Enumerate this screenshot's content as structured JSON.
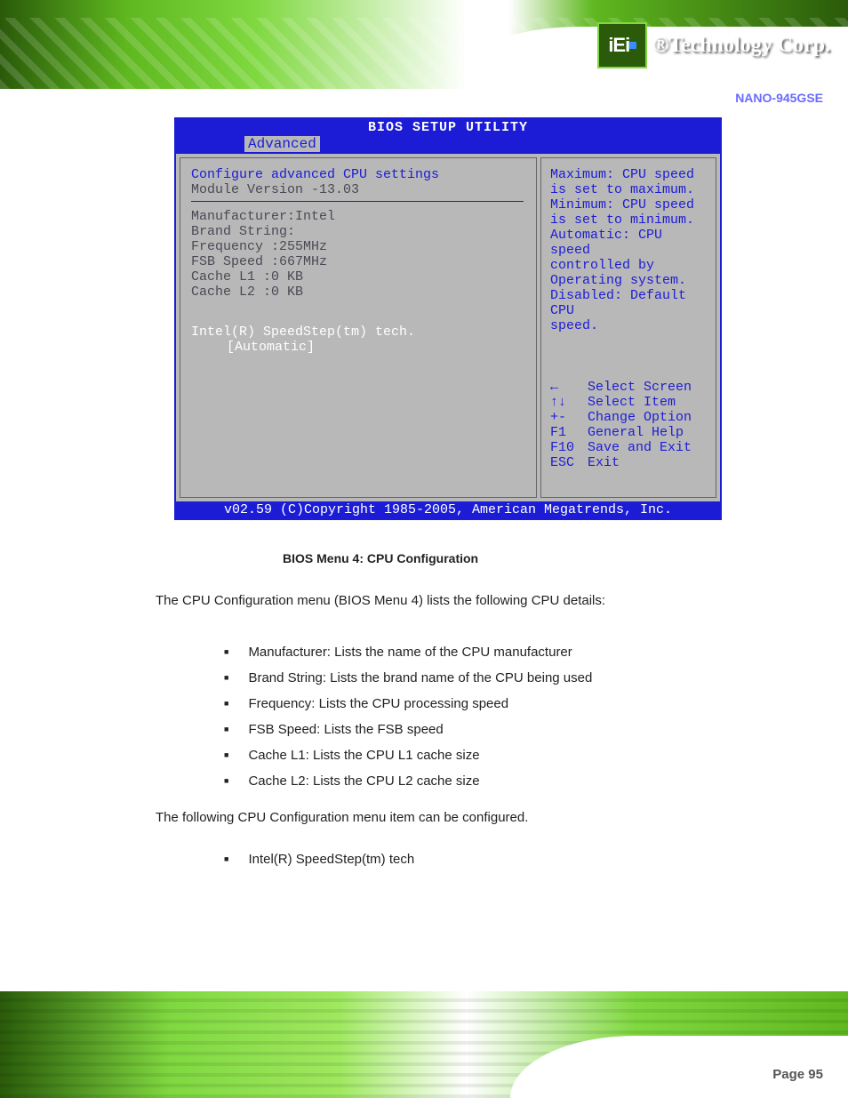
{
  "header": {
    "logo_text": "iEi",
    "brand": "®Technology Corp."
  },
  "product_label": "NANO-945GSE",
  "bios": {
    "title": "BIOS SETUP UTILITY",
    "active_tab": "Advanced",
    "left": {
      "heading": "Configure advanced CPU settings",
      "module": "Module Version -13.03",
      "rows": [
        "Manufacturer:Intel",
        "Brand String:",
        "Frequency   :255MHz",
        "FSB Speed   :667MHz",
        "",
        "Cache L1    :0 KB",
        "Cache L2    :0 KB"
      ],
      "option_label": "Intel(R) SpeedStep(tm) tech.",
      "option_value": "[Automatic]"
    },
    "right": {
      "help": [
        "Maximum: CPU speed",
        "is set to maximum.",
        "Minimum: CPU speed",
        "is set to minimum.",
        "Automatic: CPU speed",
        "controlled by",
        "Operating system.",
        "Disabled: Default CPU",
        "speed."
      ],
      "nav": [
        {
          "key": "←",
          "label": "Select Screen"
        },
        {
          "key": "↑↓",
          "label": "Select Item"
        },
        {
          "key": "+-",
          "label": "Change Option"
        },
        {
          "key": "F1",
          "label": "General Help"
        },
        {
          "key": "F10",
          "label": "Save and Exit"
        },
        {
          "key": "ESC",
          "label": "Exit"
        }
      ]
    },
    "footer": "v02.59 (C)Copyright 1985-2005, American Megatrends, Inc."
  },
  "doc": {
    "caption_bold": "BIOS Menu 4: CPU Configuration",
    "para1": "The CPU Configuration menu (BIOS Menu 4) lists the following CPU details:",
    "bullets": [
      "Manufacturer: Lists the name of the CPU manufacturer",
      "Brand String: Lists the brand name of the CPU being used",
      "Frequency: Lists the CPU processing speed",
      "FSB Speed: Lists the FSB speed",
      "Cache L1: Lists the CPU L1 cache size",
      "Cache L2: Lists the CPU L2 cache size"
    ],
    "para2": "The following CPU Configuration menu item can be configured.",
    "bullets2": [
      "Intel(R) SpeedStep(tm) tech"
    ],
    "page": "Page 95"
  }
}
